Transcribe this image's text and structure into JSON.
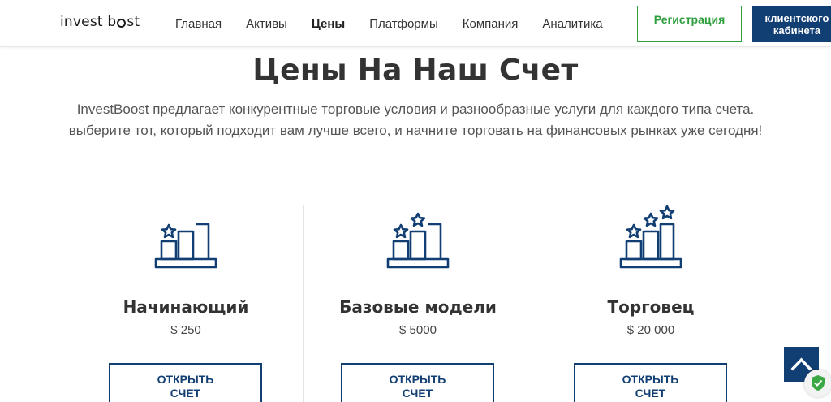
{
  "header": {
    "logo": {
      "part1": "invest b",
      "part2": "st"
    },
    "nav": [
      "Главная",
      "Активы",
      "Цены",
      "Платформы",
      "Компания",
      "Аналитика"
    ],
    "active_nav": "Цены",
    "register_label": "Регистрация",
    "cabinet_line1": "клиентского",
    "cabinet_line2": "кабинета"
  },
  "hero": {
    "title": "Цены На Наш Счет",
    "subtitle_line1": "InvestBoost предлагает конкурентные торговые условия и разнообразные услуги для каждого типа счета.",
    "subtitle_line2": "выберите тот, который подходит вам лучше всего, и начните торговать на финансовых рынках уже сегодня!"
  },
  "plans": [
    {
      "name": "Начинающий",
      "price": "$ 250",
      "button_line1": "ОТКРЫТЬ",
      "button_line2": "СЧЕТ",
      "icon": "chart-one-star-icon"
    },
    {
      "name": "Базовые модели",
      "price": "$ 5000",
      "button_line1": "ОТКРЫТЬ",
      "button_line2": "СЧЕТ",
      "icon": "chart-two-stars-icon"
    },
    {
      "name": "Торговец",
      "price": "$ 20 000",
      "button_line1": "ОТКРЫТЬ",
      "button_line2": "СЧЕТ",
      "icon": "chart-three-stars-icon"
    }
  ],
  "colors": {
    "brand": "#113e73",
    "accent": "#2e9e3e",
    "text": "#333333"
  }
}
